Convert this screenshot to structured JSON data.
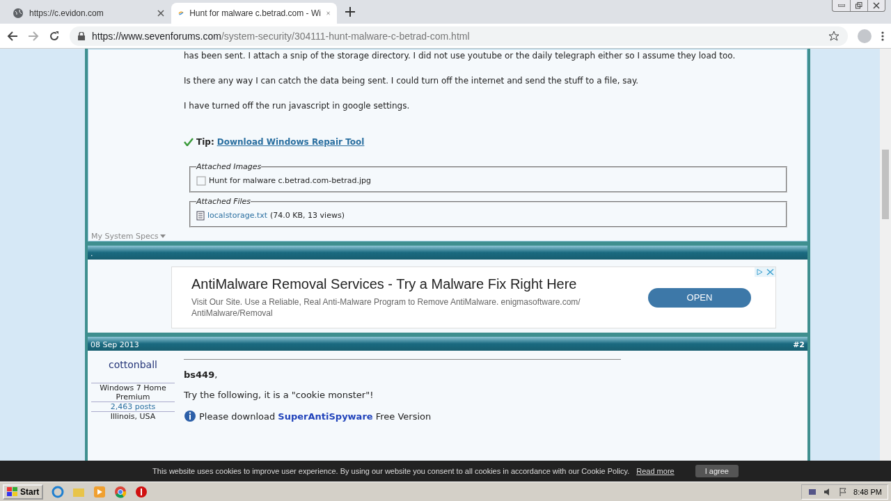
{
  "browser": {
    "tabs": [
      {
        "title": "https://c.evidon.com",
        "selected": false
      },
      {
        "title": "Hunt for malware c.betrad.com - Wi",
        "selected": true
      }
    ],
    "url": {
      "host": "https://www.sevenforums.com",
      "path": "/system-security/304111-hunt-malware-c-betrad-com.html"
    }
  },
  "post1": {
    "paragraphs": [
      "has been sent. I attach a snip of the storage directory. I did not use youtube or the daily telegraph either so I assume they load too.",
      "Is there any way I can catch the data being sent. I could turn off the internet and send the stuff to a file, say.",
      "I have turned off the run javascript in google settings."
    ],
    "tip": {
      "label": "Tip:",
      "link": "Download Windows Repair Tool"
    },
    "attached_images": {
      "legend": "Attached Images",
      "items": [
        "Hunt for malware c.betrad.com-betrad.jpg"
      ]
    },
    "attached_files": {
      "legend": "Attached Files",
      "items": [
        {
          "name": "localstorage.txt",
          "meta": "(74.0 KB, 13 views)"
        }
      ]
    },
    "specs_link": "My System Specs"
  },
  "divider_bar": {
    "text": "."
  },
  "ad": {
    "title": "AntiMalware Removal Services - Try a Malware Fix Right Here",
    "description": "Visit Our Site. Use a Reliable, Real Anti-Malware Program to Remove AntiMalware. enigmasoftware.com/ AntiMalware/Removal",
    "button": "OPEN"
  },
  "post2": {
    "date": "08 Sep 2013",
    "number": "#2",
    "user": {
      "name": "cottonball",
      "os": "Windows 7 Home Premium",
      "posts": "2,463 posts",
      "location": "Illinois, USA"
    },
    "greeting": "**bs449**,",
    "intro": "Try the following, it is a \"cookie monster\"!",
    "download": {
      "before": "Please download",
      "link": "SuperAntiSpyware",
      "after": "Free Version"
    }
  },
  "cookie_bar": {
    "text": "This website uses cookies to improve user experience. By using our website you consent to all cookies in accordance with our Cookie Policy.",
    "link": "Read more",
    "button": "I agree"
  },
  "taskbar": {
    "start": "Start",
    "clock": "8:48 PM"
  }
}
